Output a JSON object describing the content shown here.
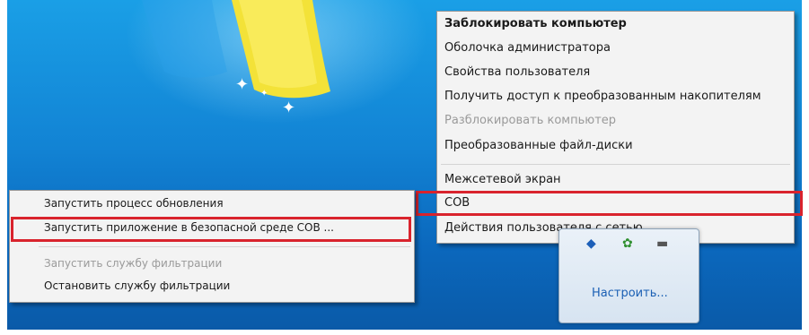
{
  "desktop": {
    "icons": {
      "sparkle": "sparkle-icon"
    }
  },
  "right_menu": {
    "items": [
      {
        "label": "Заблокировать компьютер",
        "state": "bold"
      },
      {
        "label": "Оболочка администратора",
        "state": "normal"
      },
      {
        "label": "Свойства пользователя",
        "state": "normal"
      },
      {
        "label": "Получить доступ к преобразованным накопителям",
        "state": "normal"
      },
      {
        "label": "Разблокировать компьютер",
        "state": "disabled"
      },
      {
        "label": "Преобразованные файл-диски",
        "state": "normal"
      },
      {
        "label": "Межсетевой экран",
        "state": "normal"
      },
      {
        "label": "СОВ",
        "state": "highlighted"
      },
      {
        "label": "Действия пользователя с сетью",
        "state": "normal"
      }
    ]
  },
  "left_menu": {
    "items": [
      {
        "label": "Запустить процесс обновления",
        "state": "normal"
      },
      {
        "label": "Запустить приложение в безопасной среде СОВ ...",
        "state": "highlighted"
      },
      {
        "label": "Запустить службу фильтрации",
        "state": "disabled"
      },
      {
        "label": "Остановить службу фильтрации",
        "state": "normal"
      }
    ]
  },
  "tray_popup": {
    "customize_link": "Настроить...",
    "icons": [
      "shield-icon",
      "network-icon",
      "flag-icon"
    ]
  },
  "colors": {
    "highlight_border": "#d9232d",
    "menu_background": "#f3f3f3",
    "desktop_blue": "#1283d4"
  }
}
